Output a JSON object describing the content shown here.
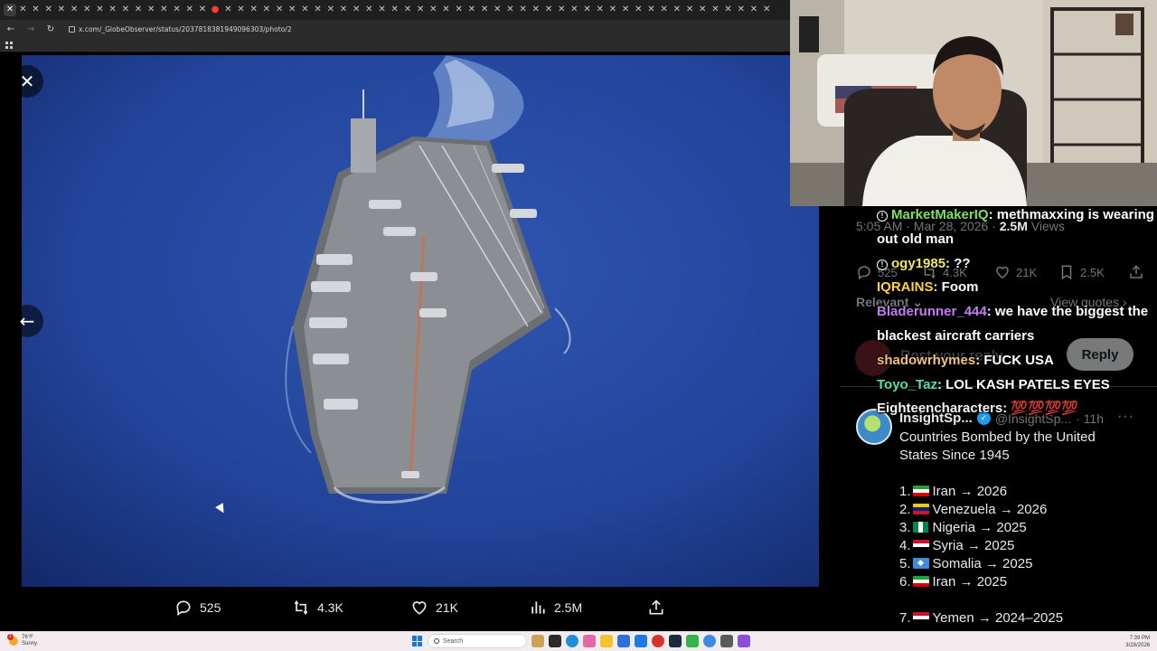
{
  "browser": {
    "tab_glyph": "✕",
    "active_tab_glyph": "✕",
    "live_tab_glyph": "●",
    "nav": {
      "back": "←",
      "forward": "→",
      "reload": "↻"
    },
    "url": "x.com/_GlobeObserver/status/2037818381949096303/photo/2"
  },
  "viewer": {
    "close_glyph": "✕",
    "prev_glyph": "←",
    "actions": {
      "replies": "525",
      "reposts": "4.3K",
      "likes": "21K",
      "views": "2.5M"
    }
  },
  "tweet": {
    "timestamp": "5:05 AM · Mar 28, 2026 · ",
    "views_count": "2.5M",
    "views_label": " Views",
    "stats": {
      "replies": "525",
      "reposts": "4.3K",
      "likes": "21K",
      "bookmarks": "2.5K"
    },
    "sort_label": "Relevant ⌄",
    "view_quotes": "View quotes ›",
    "reply_placeholder": "Post your reply",
    "reply_button": "Reply"
  },
  "post2": {
    "name": "InsightSp...",
    "handle": "@InsightSp...",
    "time": "· 11h",
    "more": "···",
    "intro_line1": "Countries Bombed by the United",
    "intro_line2": "States Since 1945",
    "list": [
      {
        "num": "1.",
        "text": "Iran → 2026",
        "flag": [
          "#239f40",
          "#ffffff",
          "#da0000"
        ]
      },
      {
        "num": "2.",
        "text": "Venezuela → 2026",
        "flag": [
          "#ffcc00",
          "#00247d",
          "#cf142b"
        ]
      },
      {
        "num": "3.",
        "text": "Nigeria → 2025",
        "flag_v": [
          "#008751",
          "#ffffff",
          "#008751"
        ]
      },
      {
        "num": "4.",
        "text": "Syria → 2025",
        "flag": [
          "#ce1126",
          "#ffffff",
          "#000000"
        ]
      },
      {
        "num": "5.",
        "text": "Somalia → 2025",
        "flag_solid": "#4189dd"
      },
      {
        "num": "6.",
        "text": "Iran → 2025",
        "flag": [
          "#239f40",
          "#ffffff",
          "#da0000"
        ]
      },
      {
        "num": "7.",
        "text": "Yemen → 2024–2025",
        "flag": [
          "#ce1126",
          "#ffffff",
          "#000000"
        ]
      }
    ]
  },
  "chat": [
    {
      "badge": true,
      "user": "MarketMakerIQ",
      "color": "#7ee25f",
      "text": ": methmaxxing is wearing out old man"
    },
    {
      "badge": true,
      "user": "ogy1985",
      "color": "#f4e66a",
      "text": ": ??"
    },
    {
      "badge": false,
      "user": "IQRAINS",
      "color": "#ffd23d",
      "text": ": Foom"
    },
    {
      "badge": false,
      "user": "Bladerunner_444",
      "color": "#c47bf2",
      "text": ": we have the biggest the blackest aircraft carriers"
    },
    {
      "badge": false,
      "user": "shadowrhymes",
      "color": "#f2c27a",
      "text": ": FUCK USA"
    },
    {
      "badge": false,
      "user": "Toyo_Taz",
      "color": "#57e0a4",
      "text": ": LOL KASH PATELS EYES"
    },
    {
      "badge": false,
      "user": "Eighteencharacters",
      "color": "#f3f3f3",
      "text": ": 💯💯💯💯"
    }
  ],
  "taskbar": {
    "weather_temp": "76°F",
    "weather_desc": "Sunny",
    "weather_badge": "1",
    "search_placeholder": "Search",
    "time": "7:39 PM",
    "date": "3/28/2026"
  },
  "colors": {
    "x_text": "#e7e9ea",
    "x_muted": "#71767b",
    "x_blue": "#1d9bf0",
    "ocean": "#1f3f8e"
  }
}
